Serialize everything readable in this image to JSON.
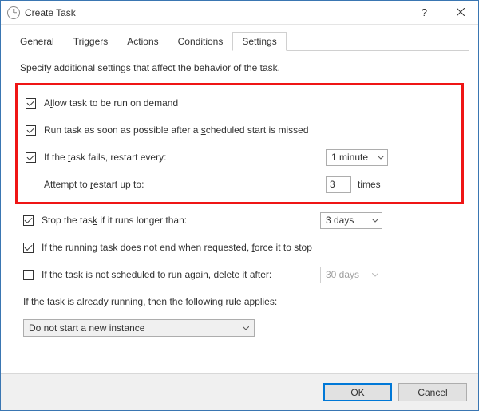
{
  "window": {
    "title": "Create Task",
    "close_icon": "close-icon"
  },
  "tabs": {
    "items": [
      {
        "label": "General"
      },
      {
        "label": "Triggers"
      },
      {
        "label": "Actions"
      },
      {
        "label": "Conditions"
      },
      {
        "label": "Settings",
        "active": true
      }
    ]
  },
  "settings": {
    "description": "Specify additional settings that affect the behavior of the task.",
    "allow_on_demand": {
      "checked": true,
      "label_pre": "A",
      "label_u": "l",
      "label_post": "low task to be run on demand"
    },
    "run_asap": {
      "checked": true,
      "label_pre": "Run task as soon as possible after a ",
      "label_u": "s",
      "label_post": "cheduled start is missed"
    },
    "restart_every": {
      "checked": true,
      "label_pre": "If the ",
      "label_u": "t",
      "label_post": "ask fails, restart every:",
      "value": "1 minute"
    },
    "attempt_restart": {
      "label_pre": "Attempt to ",
      "label_u": "r",
      "label_post": "estart up to:",
      "value": "3",
      "suffix": "times"
    },
    "stop_if_longer": {
      "checked": true,
      "label_pre": "Stop the tas",
      "label_u": "k",
      "label_post": " if it runs longer than:",
      "value": "3 days"
    },
    "force_stop": {
      "checked": true,
      "label_pre": "If the running task does not end when requested, ",
      "label_u": "f",
      "label_post": "orce it to stop"
    },
    "delete_after": {
      "checked": false,
      "label_pre": "If the task is not scheduled to run again, ",
      "label_u": "d",
      "label_post": "elete it after:",
      "value": "30 days"
    },
    "rule_label": "If the task is already running, then the following rule applies:",
    "rule_value": "Do not start a new instance"
  },
  "footer": {
    "ok": "OK",
    "cancel": "Cancel"
  }
}
